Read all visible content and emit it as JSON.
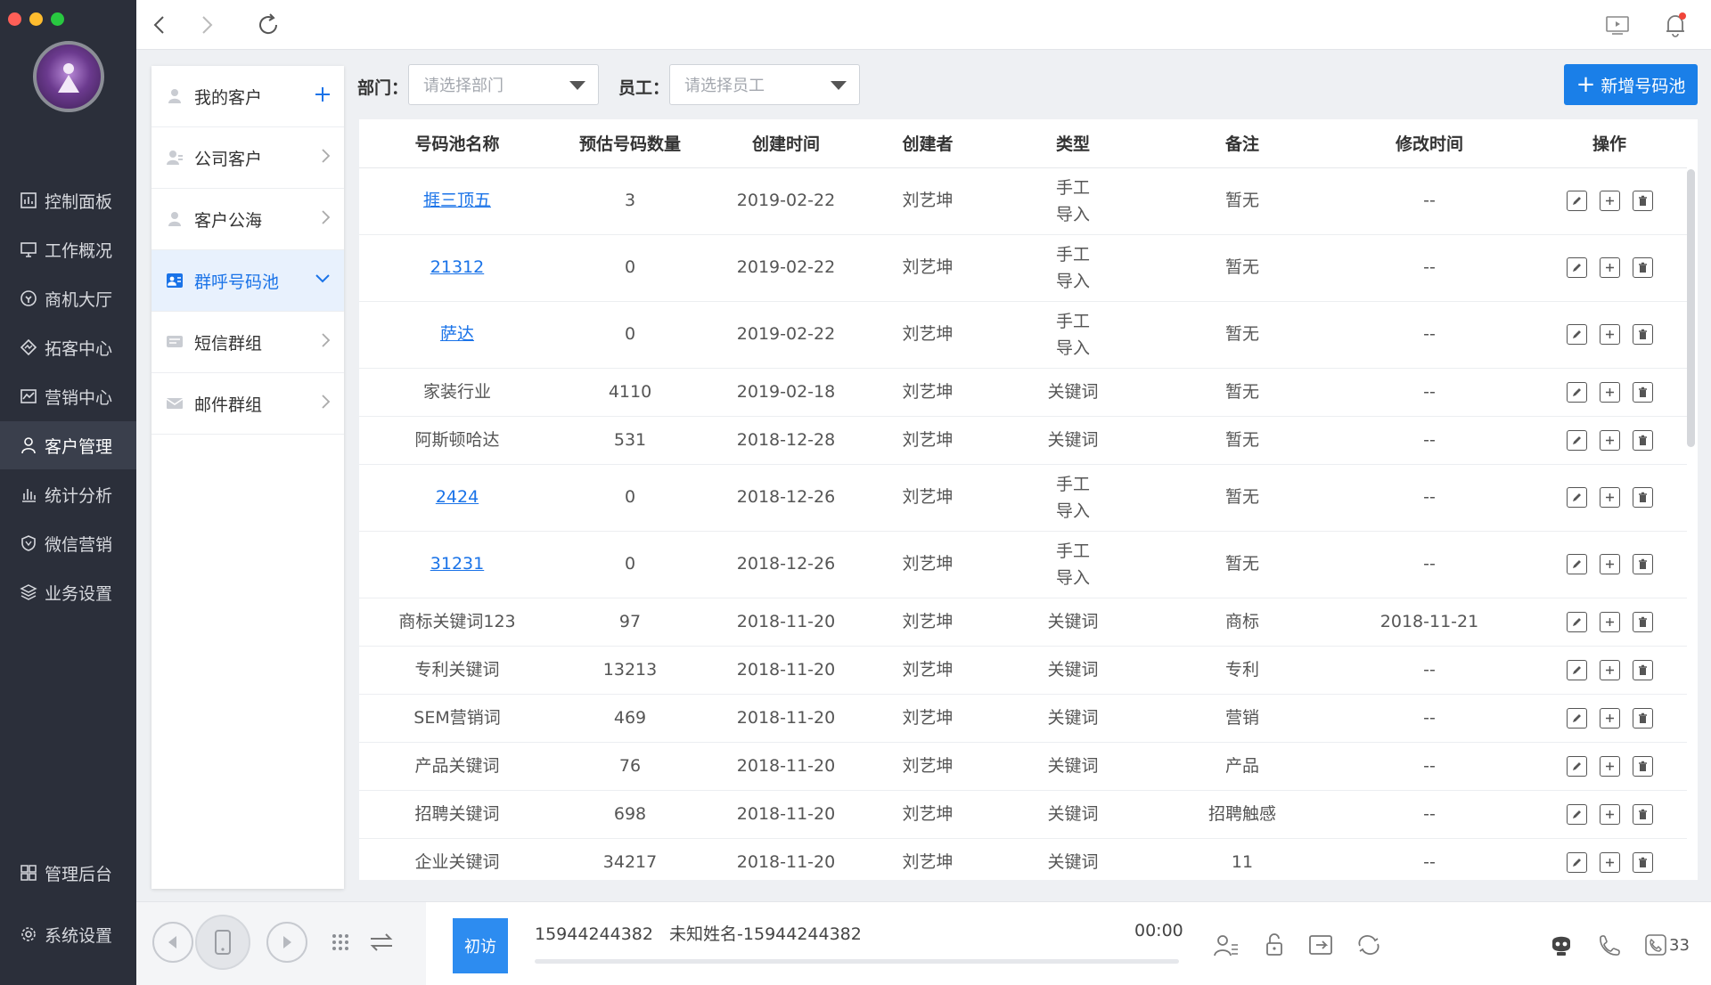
{
  "window": {
    "controls": [
      "close",
      "minimize",
      "maximize"
    ]
  },
  "sidebar": {
    "items": [
      {
        "label": "控制面板",
        "icon": "dashboard-icon"
      },
      {
        "label": "工作概况",
        "icon": "monitor-icon"
      },
      {
        "label": "商机大厅",
        "icon": "opportunity-icon"
      },
      {
        "label": "拓客中心",
        "icon": "expand-icon"
      },
      {
        "label": "营销中心",
        "icon": "chart-icon"
      },
      {
        "label": "客户管理",
        "icon": "customer-icon",
        "active": true
      },
      {
        "label": "统计分析",
        "icon": "bar-chart-icon"
      },
      {
        "label": "微信营销",
        "icon": "shield-icon"
      },
      {
        "label": "业务设置",
        "icon": "layers-icon"
      }
    ],
    "bottom_items": [
      {
        "label": "管理后台",
        "icon": "grid-icon"
      },
      {
        "label": "系统设置",
        "icon": "gear-icon"
      }
    ]
  },
  "submenu": {
    "items": [
      {
        "label": "我的客户",
        "right": "plus"
      },
      {
        "label": "公司客户",
        "right": "chevron-right"
      },
      {
        "label": "客户公海",
        "right": "chevron-right"
      },
      {
        "label": "群呼号码池",
        "right": "chevron-down",
        "active": true
      },
      {
        "label": "短信群组",
        "right": "chevron-right"
      },
      {
        "label": "邮件群组",
        "right": "chevron-right"
      }
    ]
  },
  "filters": {
    "department_label": "部门：",
    "department_placeholder": "请选择部门",
    "employee_label": "员工：",
    "employee_placeholder": "请选择员工"
  },
  "add_button": {
    "label": "新增号码池"
  },
  "table": {
    "headers": [
      "号码池名称",
      "预估号码数量",
      "创建时间",
      "创建者",
      "类型",
      "备注",
      "修改时间",
      "操作"
    ],
    "rows": [
      {
        "name": "捱三顶五",
        "link": true,
        "count": "3",
        "created": "2019-02-22",
        "creator": "刘艺坤",
        "type": "手工导入",
        "note": "暂无",
        "modified": "--"
      },
      {
        "name": "21312",
        "link": true,
        "count": "0",
        "created": "2019-02-22",
        "creator": "刘艺坤",
        "type": "手工导入",
        "note": "暂无",
        "modified": "--"
      },
      {
        "name": "萨达",
        "link": true,
        "count": "0",
        "created": "2019-02-22",
        "creator": "刘艺坤",
        "type": "手工导入",
        "note": "暂无",
        "modified": "--"
      },
      {
        "name": "家装行业",
        "link": false,
        "count": "4110",
        "created": "2019-02-18",
        "creator": "刘艺坤",
        "type": "关键词",
        "note": "暂无",
        "modified": "--"
      },
      {
        "name": "阿斯顿哈达",
        "link": false,
        "count": "531",
        "created": "2018-12-28",
        "creator": "刘艺坤",
        "type": "关键词",
        "note": "暂无",
        "modified": "--"
      },
      {
        "name": "2424",
        "link": true,
        "count": "0",
        "created": "2018-12-26",
        "creator": "刘艺坤",
        "type": "手工导入",
        "note": "暂无",
        "modified": "--"
      },
      {
        "name": "31231",
        "link": true,
        "count": "0",
        "created": "2018-12-26",
        "creator": "刘艺坤",
        "type": "手工导入",
        "note": "暂无",
        "modified": "--"
      },
      {
        "name": "商标关键词123",
        "link": false,
        "count": "97",
        "created": "2018-11-20",
        "creator": "刘艺坤",
        "type": "关键词",
        "note": "商标",
        "modified": "2018-11-21"
      },
      {
        "name": "专利关键词",
        "link": false,
        "count": "13213",
        "created": "2018-11-20",
        "creator": "刘艺坤",
        "type": "关键词",
        "note": "专利",
        "modified": "--"
      },
      {
        "name": "SEM营销词",
        "link": false,
        "count": "469",
        "created": "2018-11-20",
        "creator": "刘艺坤",
        "type": "关键词",
        "note": "营销",
        "modified": "--"
      },
      {
        "name": "产品关键词",
        "link": false,
        "count": "76",
        "created": "2018-11-20",
        "creator": "刘艺坤",
        "type": "关键词",
        "note": "产品",
        "modified": "--"
      },
      {
        "name": "招聘关键词",
        "link": false,
        "count": "698",
        "created": "2018-11-20",
        "creator": "刘艺坤",
        "type": "关键词",
        "note": "招聘触感",
        "modified": "--"
      },
      {
        "name": "企业关键词",
        "link": false,
        "count": "34217",
        "created": "2018-11-20",
        "creator": "刘艺坤",
        "type": "关键词",
        "note": "11",
        "modified": "--"
      }
    ]
  },
  "callbar": {
    "tag_label": "初访",
    "number": "15944244382",
    "contact": "未知姓名-15944244382",
    "time": "00:00",
    "call_count": "33"
  },
  "colors": {
    "accent": "#1a7fe8",
    "sidebar_bg": "#2b2f3a"
  }
}
